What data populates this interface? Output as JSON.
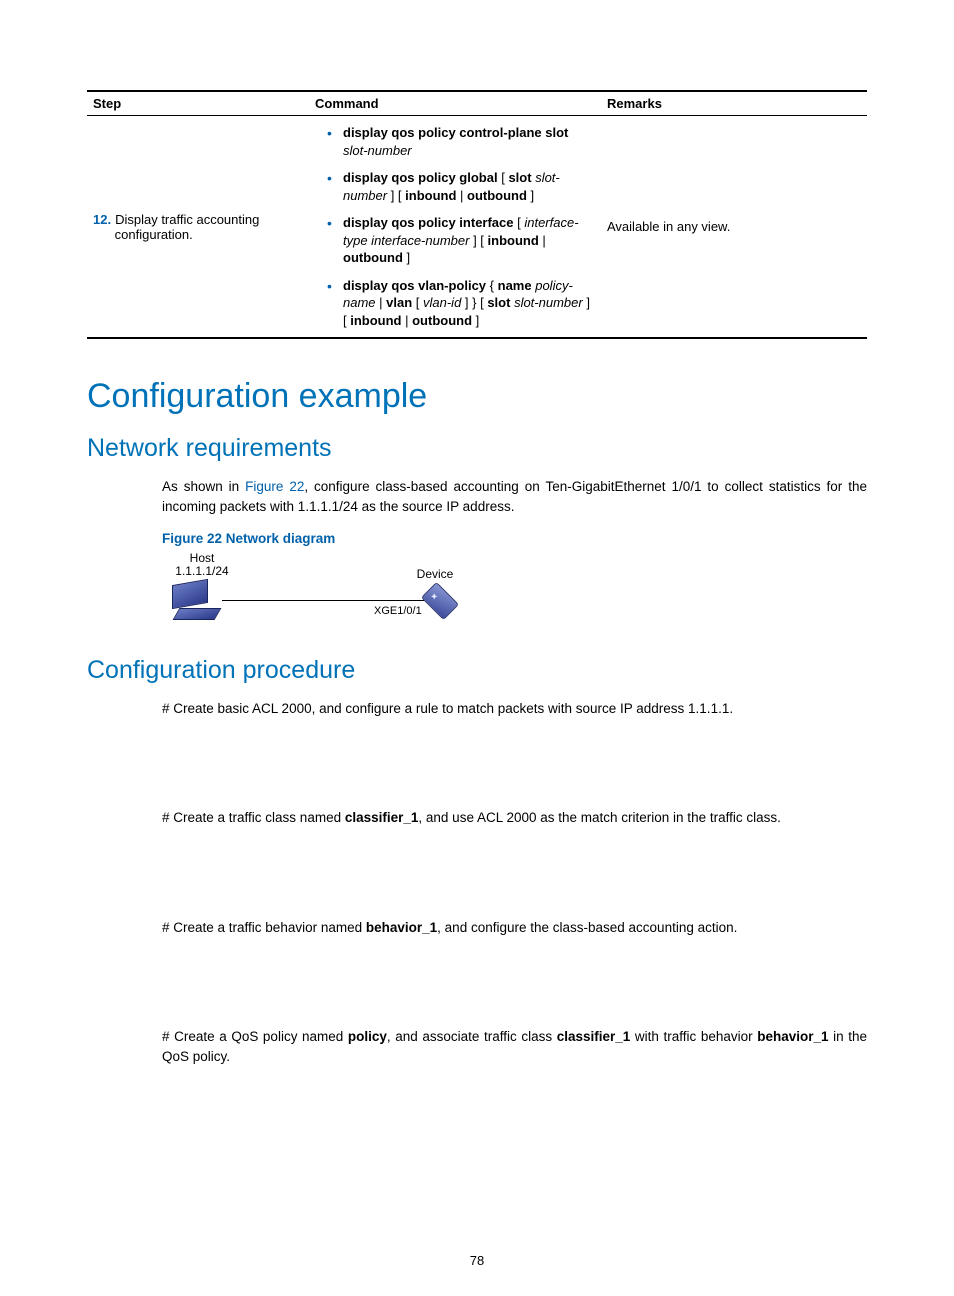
{
  "table": {
    "headers": {
      "step": "Step",
      "command": "Command",
      "remarks": "Remarks"
    },
    "row": {
      "step_num": "12.",
      "step_text": "Display traffic accounting\nconfiguration.",
      "commands": [
        {
          "html": "<span class='b'>display qos policy control-plane slot</span> <span class='i'>slot-number</span>"
        },
        {
          "html": "<span class='b'>display qos policy global</span> [ <span class='b'>slot</span> <span class='i'>slot-number</span> ] [ <span class='b'>inbound</span> | <span class='b'>outbound</span> ]"
        },
        {
          "html": "<span class='b'>display qos policy interface</span> [ <span class='i'>interface-type interface-number</span> ] [ <span class='b'>inbound</span> | <span class='b'>outbound</span> ]"
        },
        {
          "html": "<span class='b'>display qos vlan-policy</span> { <span class='b'>name</span> <span class='i'>policy-name</span> | <span class='b'>vlan</span> [ <span class='i'>vlan-id</span> ] } [ <span class='b'>slot</span> <span class='i'>slot-number</span> ] [ <span class='b'>inbound</span> | <span class='b'>outbound</span> ]"
        }
      ],
      "remarks": "Available in any view."
    }
  },
  "headings": {
    "h1": "Configuration example",
    "h2a": "Network requirements",
    "h2b": "Configuration procedure"
  },
  "netreq": {
    "para_pre": "As shown in ",
    "figref": "Figure 22",
    "para_post": ", configure class-based accounting on Ten-GigabitEthernet 1/0/1 to collect statistics for the incoming packets with 1.1.1.1/24 as the source IP address.",
    "fig_caption": "Figure 22 Network diagram",
    "diagram": {
      "host_line1": "Host",
      "host_line2": "1.1.1.1/24",
      "device": "Device",
      "port": "XGE1/0/1"
    }
  },
  "procedure": {
    "p1": "# Create basic ACL 2000, and configure a rule to match packets with source IP address 1.1.1.1.",
    "p2_pre": "# Create a traffic class named ",
    "p2_b1": "classifier_1",
    "p2_post": ", and use ACL 2000 as the match criterion in the traffic class.",
    "p3_pre": "# Create a traffic behavior named ",
    "p3_b1": "behavior_1",
    "p3_post": ", and configure the class-based accounting action.",
    "p4_pre": "# Create a QoS policy named ",
    "p4_b1": "policy",
    "p4_mid1": ", and associate traffic class ",
    "p4_b2": "classifier_1",
    "p4_mid2": " with traffic behavior ",
    "p4_b3": "behavior_1",
    "p4_post": " in the QoS policy."
  },
  "pagenum": "78"
}
